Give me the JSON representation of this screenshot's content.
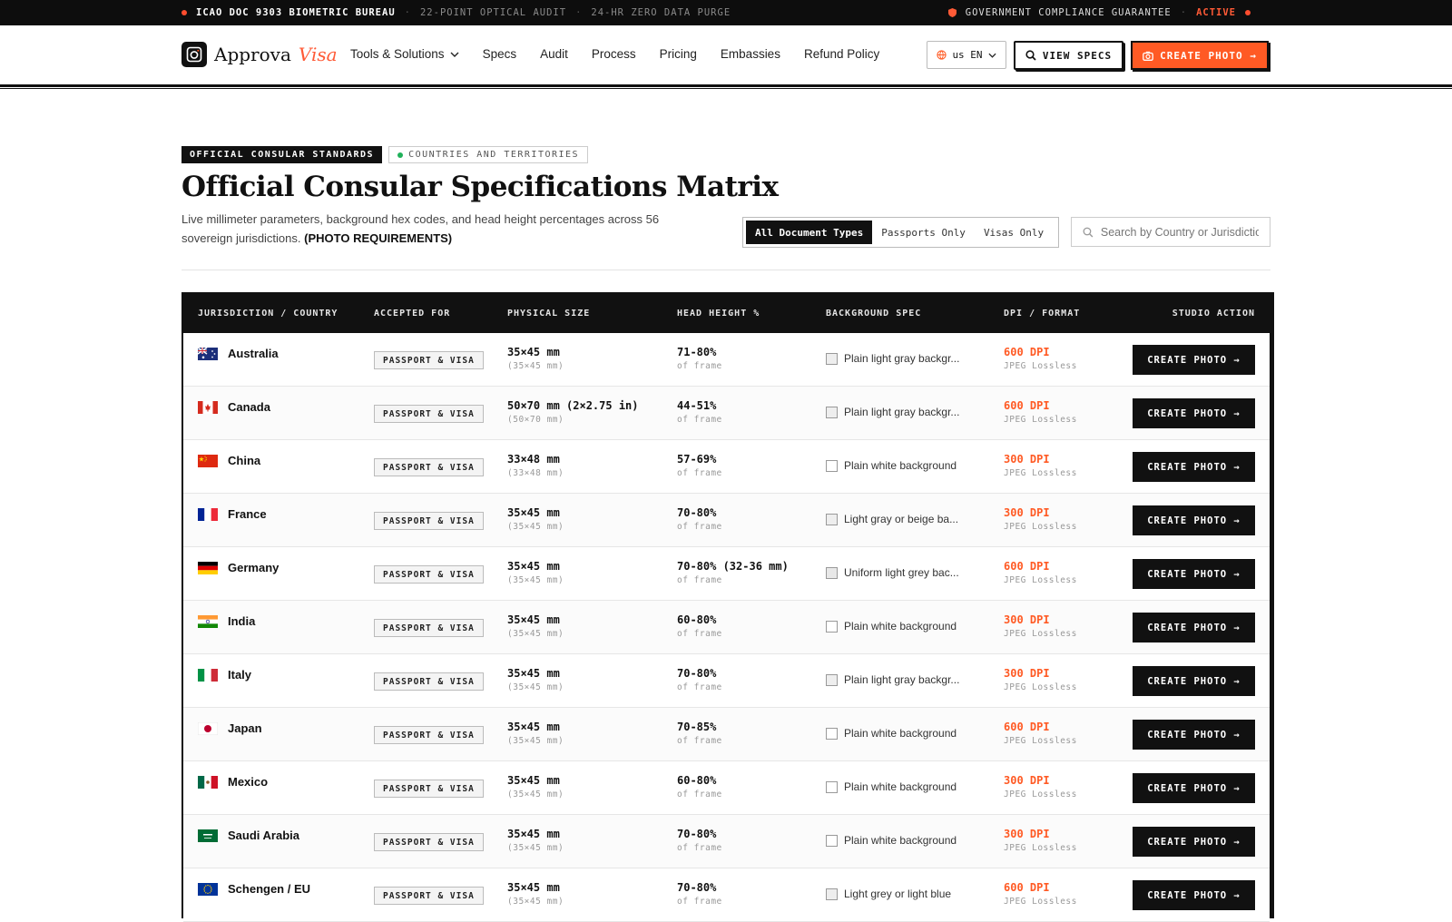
{
  "topbar": {
    "bureau": "ICAO DOC 9303 BIOMETRIC BUREAU",
    "audit": "22-POINT OPTICAL AUDIT",
    "purge": "24-HR ZERO DATA PURGE",
    "guarantee": "GOVERNMENT COMPLIANCE GUARANTEE",
    "status": "ACTIVE"
  },
  "header": {
    "logo_name": "Approva",
    "logo_accent": "Visa",
    "nav": [
      "Tools & Solutions",
      "Specs",
      "Audit",
      "Process",
      "Pricing",
      "Embassies",
      "Refund Policy"
    ],
    "lang_label": "us EN",
    "view_specs_label": "VIEW SPECS",
    "create_label": "CREATE PHOTO →"
  },
  "hero": {
    "badge_primary": "OFFICIAL CONSULAR STANDARDS",
    "badge_secondary": "COUNTRIES AND TERRITORIES",
    "title": "Official Consular Specifications Matrix",
    "subtitle": "Live millimeter parameters, background hex codes, and head height percentages across 56 sovereign jurisdictions.",
    "subtitle_strong": "(PHOTO REQUIREMENTS)"
  },
  "filters": {
    "options": [
      "All Document Types",
      "Passports Only",
      "Visas Only"
    ],
    "active": "All Document Types",
    "search_placeholder": "Search by Country or Jurisdiction"
  },
  "table": {
    "headers": [
      "JURISDICTION / COUNTRY",
      "ACCEPTED FOR",
      "PHYSICAL SIZE",
      "HEAD HEIGHT %",
      "BACKGROUND SPEC",
      "DPI / FORMAT",
      "STUDIO ACTION"
    ],
    "head_sub": "of frame",
    "format_sub": "JPEG Lossless",
    "action_label": "CREATE PHOTO →",
    "rows": [
      {
        "country": "Australia",
        "flag": "au",
        "accepted": "PASSPORT & VISA",
        "size": "35×45 mm",
        "size_sub": "(35×45 mm)",
        "head": "71-80%",
        "bg": "Plain light gray backgr...",
        "bg_color": "#eeeeee",
        "dpi": "600 DPI"
      },
      {
        "country": "Canada",
        "flag": "ca",
        "accepted": "PASSPORT & VISA",
        "size": "50×70 mm (2×2.75 in)",
        "size_sub": "(50×70 mm)",
        "head": "44-51%",
        "bg": "Plain light gray backgr...",
        "bg_color": "#eeeeee",
        "dpi": "600 DPI"
      },
      {
        "country": "China",
        "flag": "cn",
        "accepted": "PASSPORT & VISA",
        "size": "33×48 mm",
        "size_sub": "(33×48 mm)",
        "head": "57-69%",
        "bg": "Plain white background",
        "bg_color": "#ffffff",
        "dpi": "300 DPI"
      },
      {
        "country": "France",
        "flag": "fr",
        "accepted": "PASSPORT & VISA",
        "size": "35×45 mm",
        "size_sub": "(35×45 mm)",
        "head": "70-80%",
        "bg": "Light gray or beige ba...",
        "bg_color": "#eeeeee",
        "dpi": "300 DPI"
      },
      {
        "country": "Germany",
        "flag": "de",
        "accepted": "PASSPORT & VISA",
        "size": "35×45 mm",
        "size_sub": "(35×45 mm)",
        "head": "70-80% (32-36 mm)",
        "bg": "Uniform light grey bac...",
        "bg_color": "#e8e8e8",
        "dpi": "600 DPI"
      },
      {
        "country": "India",
        "flag": "in",
        "accepted": "PASSPORT & VISA",
        "size": "35×45 mm",
        "size_sub": "(35×45 mm)",
        "head": "60-80%",
        "bg": "Plain white background",
        "bg_color": "#ffffff",
        "dpi": "300 DPI"
      },
      {
        "country": "Italy",
        "flag": "it",
        "accepted": "PASSPORT & VISA",
        "size": "35×45 mm",
        "size_sub": "(35×45 mm)",
        "head": "70-80%",
        "bg": "Plain light gray backgr...",
        "bg_color": "#eeeeee",
        "dpi": "300 DPI"
      },
      {
        "country": "Japan",
        "flag": "jp",
        "accepted": "PASSPORT & VISA",
        "size": "35×45 mm",
        "size_sub": "(35×45 mm)",
        "head": "70-85%",
        "bg": "Plain white background",
        "bg_color": "#ffffff",
        "dpi": "600 DPI"
      },
      {
        "country": "Mexico",
        "flag": "mx",
        "accepted": "PASSPORT & VISA",
        "size": "35×45 mm",
        "size_sub": "(35×45 mm)",
        "head": "60-80%",
        "bg": "Plain white background",
        "bg_color": "#ffffff",
        "dpi": "300 DPI"
      },
      {
        "country": "Saudi Arabia",
        "flag": "sa",
        "accepted": "PASSPORT & VISA",
        "size": "35×45 mm",
        "size_sub": "(35×45 mm)",
        "head": "70-80%",
        "bg": "Plain white background",
        "bg_color": "#ffffff",
        "dpi": "300 DPI"
      },
      {
        "country": "Schengen / EU",
        "flag": "eu",
        "accepted": "PASSPORT & VISA",
        "size": "35×45 mm",
        "size_sub": "(35×45 mm)",
        "head": "70-80%",
        "bg": "Light grey or light blue",
        "bg_color": "#eeeeee",
        "dpi": "600 DPI"
      }
    ]
  },
  "colors": {
    "accent": "#ff5a24",
    "ink": "#111111",
    "status_active": "#ff5a36",
    "status_ok": "#20b15a"
  }
}
